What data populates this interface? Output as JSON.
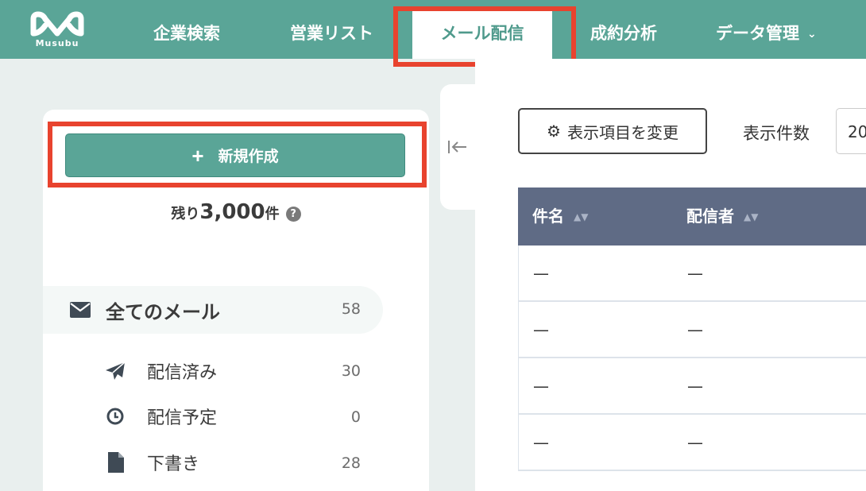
{
  "app": {
    "logo_text": "Musubu"
  },
  "nav": {
    "items": [
      {
        "label": "企業検索"
      },
      {
        "label": "営業リスト"
      },
      {
        "label": "メール配信"
      },
      {
        "label": "成約分析"
      },
      {
        "label": "データ管理"
      }
    ],
    "active_index": 2
  },
  "sidebar": {
    "new_button_label": "新規作成",
    "remaining_prefix": "残り",
    "remaining_value": "3,000",
    "remaining_suffix": "件",
    "help_glyph": "?",
    "menu": [
      {
        "label": "全てのメール",
        "count": "58",
        "icon": "envelope-icon"
      },
      {
        "label": "配信済み",
        "count": "30",
        "icon": "paper-plane-icon"
      },
      {
        "label": "配信予定",
        "count": "0",
        "icon": "clock-icon"
      },
      {
        "label": "下書き",
        "count": "28",
        "icon": "document-icon"
      }
    ]
  },
  "toolbar": {
    "column_button_label": "表示項目を変更",
    "count_label": "表示件数",
    "count_value": "20"
  },
  "table": {
    "headers": [
      "件名",
      "配信者"
    ],
    "rows": [
      [
        "—",
        "—"
      ],
      [
        "—",
        "—"
      ],
      [
        "—",
        "—"
      ],
      [
        "—",
        "—"
      ]
    ]
  },
  "colors": {
    "brand": "#5aa597",
    "table_header": "#5f6b85",
    "highlight": "#e8432e"
  }
}
